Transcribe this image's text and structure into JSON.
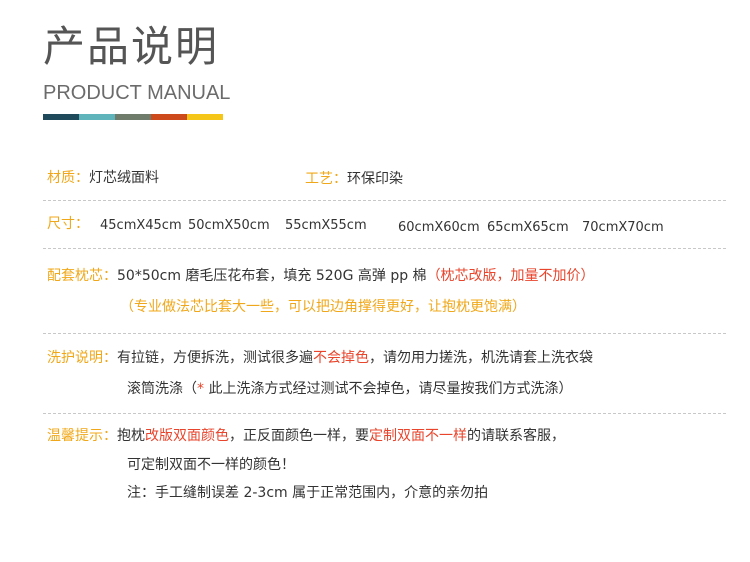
{
  "header": {
    "title_cn": "产品说明",
    "title_en": "PRODUCT MANUAL",
    "bar_colors": [
      "#1f4a5c",
      "#5fb3ba",
      "#6f7c6c",
      "#cd4a1c",
      "#f5c518"
    ]
  },
  "material": {
    "label": "材质：",
    "value": "灯芯绒面料"
  },
  "craft": {
    "label": "工艺：",
    "value": "环保印染"
  },
  "size": {
    "label": "尺寸：",
    "options": [
      "45cmX45cm",
      "50cmX50cm",
      "55cmX55cm",
      "60cmX60cm",
      "65cmX65cm",
      "70cmX70cm"
    ]
  },
  "core": {
    "label": "配套枕芯：",
    "text": "50*50cm 磨毛压花布套，填充 520G 高弹 pp 棉",
    "highlight": "（枕芯改版，加量不加价）",
    "note": "（专业做法芯比套大一些，可以把边角撑得更好，让抱枕更饱满）"
  },
  "wash": {
    "label": "洗护说明：",
    "text_a": "有拉链，方便拆洗，测试很多遍",
    "highlight": "不会掉色",
    "text_b": "，请勿用力搓洗，机洗请套上洗衣袋",
    "line2_a": "滚筒洗涤（",
    "line2_star": "*",
    "line2_b": " 此上洗涤方式经过测试不会掉色，请尽量按我们方式洗涤）"
  },
  "tip": {
    "label": "温馨提示：",
    "t1": "抱枕",
    "h1": "改版双面颜色",
    "t2": "，正反面颜色一样，要",
    "h2": "定制双面不一样",
    "t3": "的请联系客服，",
    "line2": "可定制双面不一样的颜色！",
    "line3": "注：手工缝制误差 2-3cm 属于正常范围内，介意的亲勿拍"
  }
}
